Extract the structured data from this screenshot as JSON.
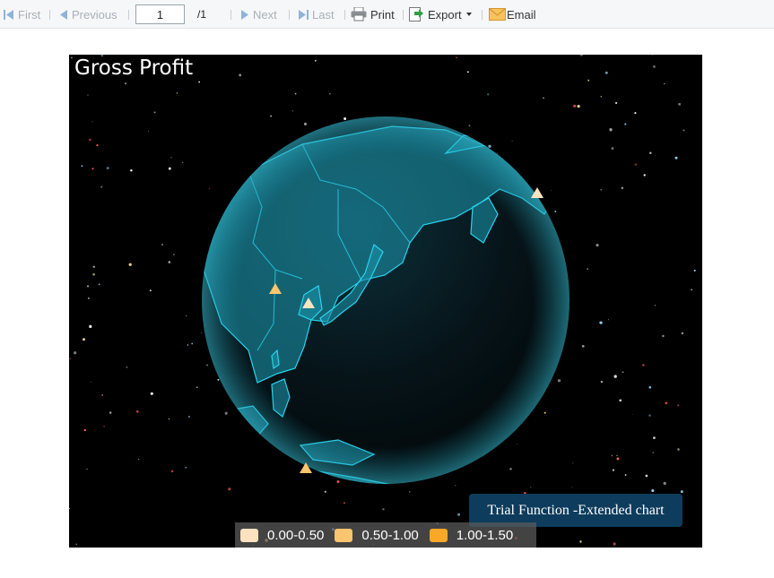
{
  "toolbar": {
    "first_label": "First",
    "previous_label": "Previous",
    "page_value": "1",
    "page_total": "/1",
    "next_label": "Next",
    "last_label": "Last",
    "print_label": "Print",
    "export_label": "Export",
    "email_label": "Email"
  },
  "chart": {
    "title": "Gross Profit",
    "trial_notice": "Trial Function -Extended chart",
    "legend": [
      {
        "label": "0.00-0.50",
        "color": "#fde2c0"
      },
      {
        "label": "0.50-1.00",
        "color": "#fbc46e"
      },
      {
        "label": "1.00-1.50",
        "color": "#f8a726"
      }
    ],
    "colors": {
      "globe": "#1a8fa5",
      "land_border": "#29d4ef",
      "background": "#000000"
    }
  }
}
